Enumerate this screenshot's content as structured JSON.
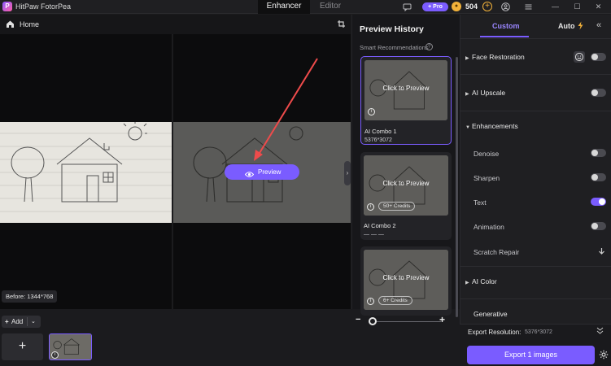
{
  "app": {
    "title": "HitPaw FotorPea",
    "logo_letter": "P",
    "tabs": [
      {
        "label": "Enhancer",
        "active": true
      },
      {
        "label": "Editor",
        "active": false
      }
    ],
    "pro_label": "+ Pro",
    "credits": "504",
    "window_controls": {
      "minimize": "—",
      "maximize": "☐",
      "close": "✕"
    }
  },
  "editor": {
    "home_label": "Home",
    "before_tag": "Before: 1344*768",
    "preview_button": "Preview",
    "collapse_glyph": "›",
    "add_button": {
      "plus": "+",
      "label": "Add",
      "chevron": "⌄"
    },
    "add_tile_plus": "+",
    "zoom": {
      "minus": "−",
      "plus": "+",
      "level": 0.0
    }
  },
  "history": {
    "title": "Preview History",
    "smart_label": "Smart Recommendations",
    "help_glyph": "?",
    "cards": [
      {
        "cta": "Click to Preview",
        "name": "AI Combo 1",
        "sub": "5376*3072",
        "credits": "",
        "selected": true
      },
      {
        "cta": "Click to Preview",
        "name": "AI Combo 2",
        "sub": "— — —",
        "credits": "50+ Credits",
        "selected": false
      },
      {
        "cta": "Click to Preview",
        "name": "",
        "sub": "",
        "credits": "6+ Credits",
        "selected": false
      }
    ]
  },
  "settings": {
    "tab_custom": "Custom",
    "tab_auto": "Auto",
    "close_glyph": "«",
    "sections": {
      "face_restoration": "Face Restoration",
      "ai_upscale": "AI Upscale",
      "enhancements": "Enhancements",
      "ai_color": "AI Color",
      "generative": "Generative"
    },
    "enhancement_items": [
      {
        "label": "Denoise",
        "on": false
      },
      {
        "label": "Sharpen",
        "on": false
      },
      {
        "label": "Text",
        "on": true
      },
      {
        "label": "Animation",
        "on": false
      },
      {
        "label": "Scratch Repair",
        "on": false
      }
    ],
    "face_restoration_on": false,
    "ai_upscale_on": false,
    "export_resolution_label": "Export Resolution:",
    "export_resolution_value": "5376*3072",
    "export_button": "Export 1 images",
    "icons": {
      "home": "home-icon",
      "crop": "crop-icon",
      "eye": "eye-icon",
      "bolt": "bolt-icon",
      "gear": "gear-icon",
      "info": "info-icon"
    },
    "colors": {
      "accent": "#7a5cff",
      "coin": "#f3b23a"
    }
  }
}
